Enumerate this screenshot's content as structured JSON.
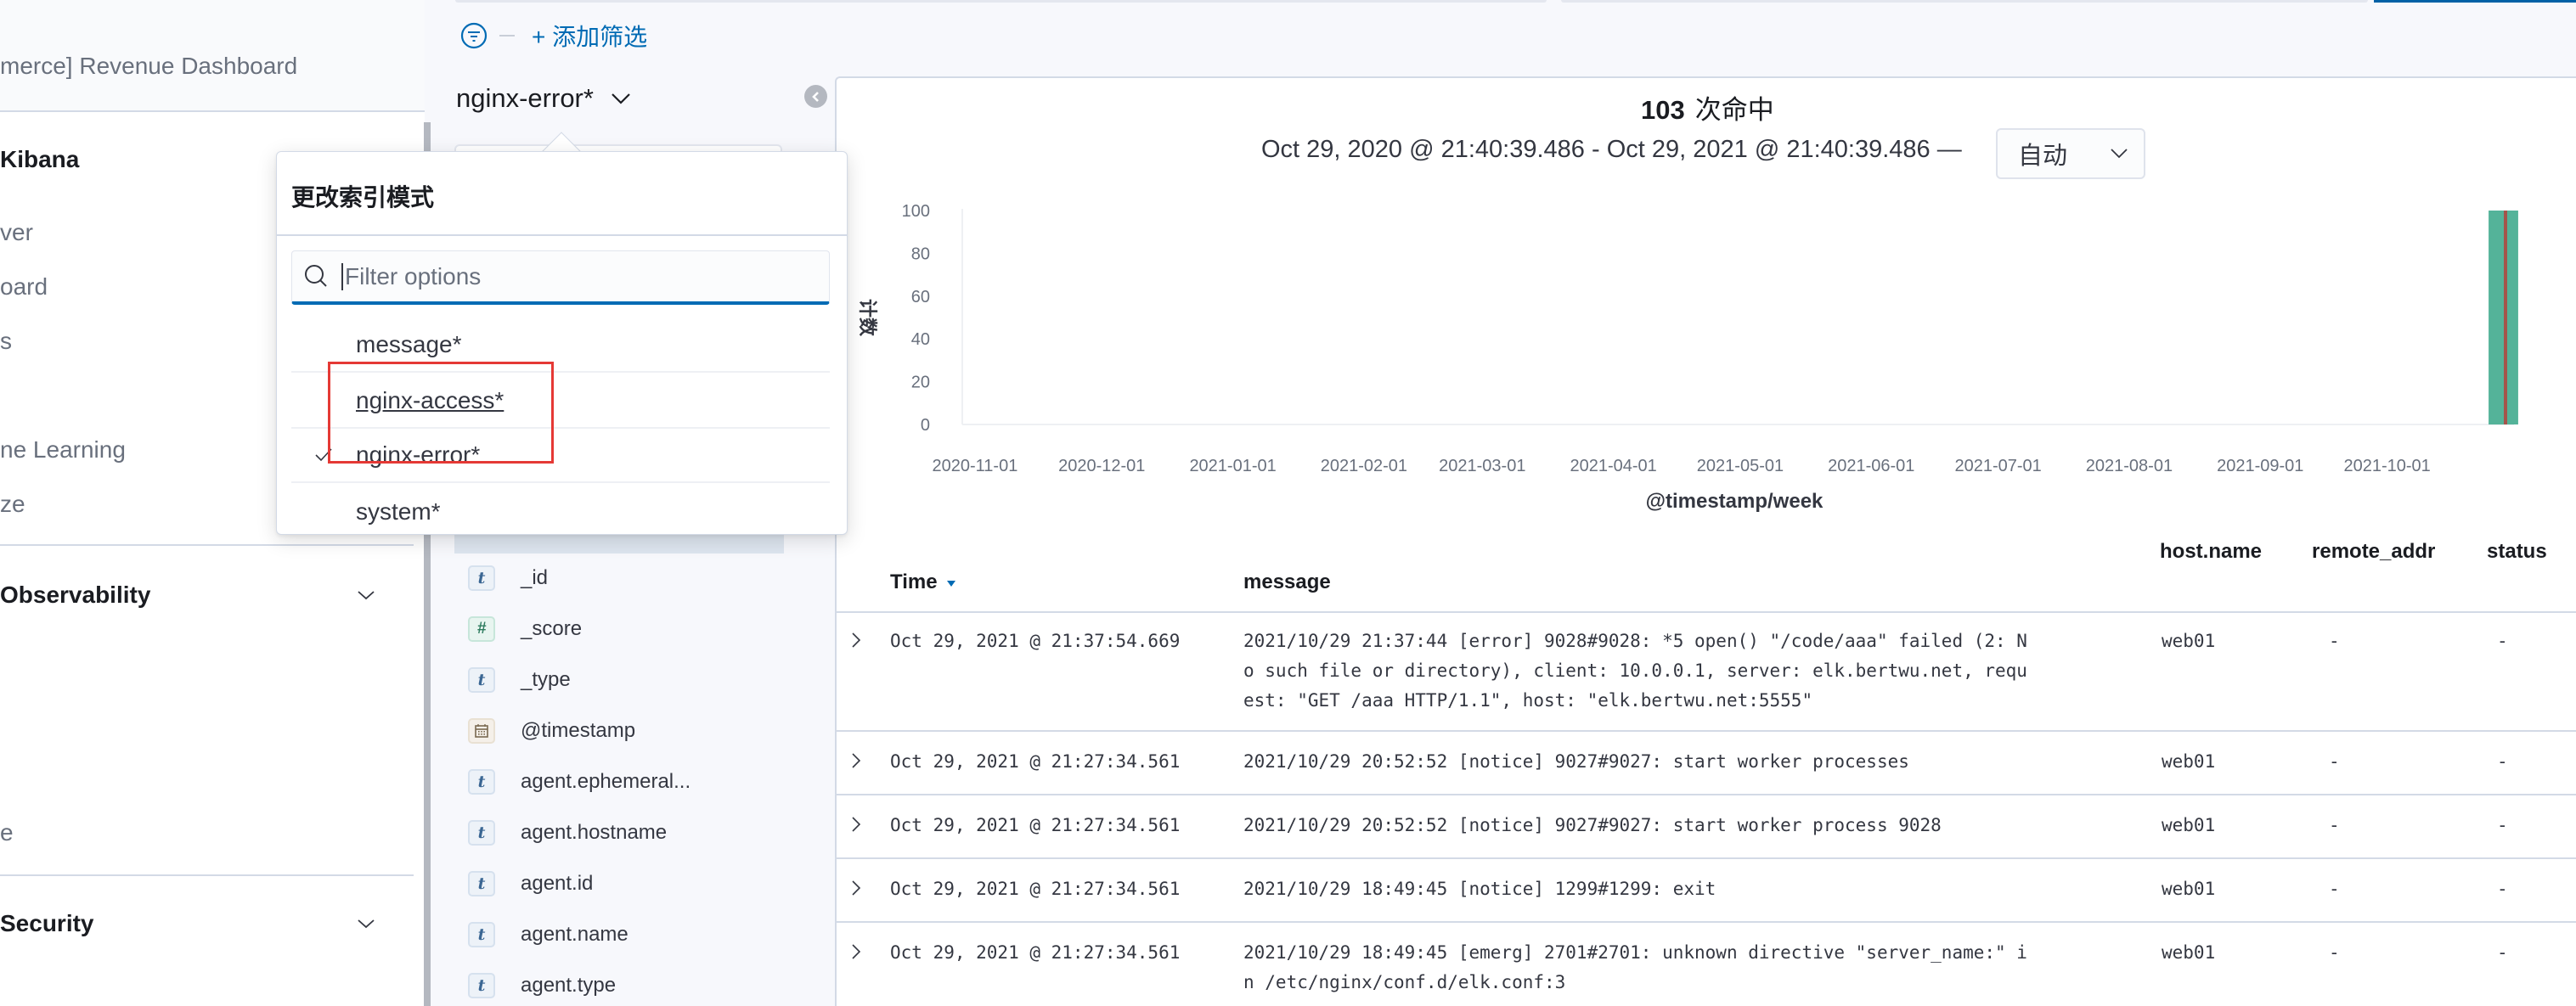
{
  "sidebar": {
    "recent_item": "merce] Revenue Dashboard",
    "groups": [
      {
        "title": "Kibana",
        "items": [
          "ver",
          "oard",
          "s",
          "",
          "ne Learning",
          "ze"
        ]
      },
      {
        "title": "Observability",
        "items": [
          "",
          "",
          "",
          "",
          "e"
        ]
      },
      {
        "title": "Security",
        "items": []
      }
    ]
  },
  "filter_bar": {
    "add_filter_label": "+ 添加筛选"
  },
  "index_selector": {
    "current": "nginx-error*"
  },
  "index_popover": {
    "title": "更改索引模式",
    "search_placeholder": "Filter options",
    "search_value": "",
    "options": [
      {
        "label": "message*",
        "selected": false,
        "focused": false
      },
      {
        "label": "nginx-access*",
        "selected": false,
        "focused": true
      },
      {
        "label": "nginx-error*",
        "selected": true,
        "focused": false
      },
      {
        "label": "system*",
        "selected": false,
        "focused": false
      }
    ]
  },
  "fields": [
    {
      "name": "_id",
      "type": "t"
    },
    {
      "name": "_score",
      "type": "#"
    },
    {
      "name": "_type",
      "type": "t"
    },
    {
      "name": "@timestamp",
      "type": "date"
    },
    {
      "name": "agent.ephemeral...",
      "type": "t"
    },
    {
      "name": "agent.hostname",
      "type": "t"
    },
    {
      "name": "agent.id",
      "type": "t"
    },
    {
      "name": "agent.name",
      "type": "t"
    },
    {
      "name": "agent.type",
      "type": "t"
    }
  ],
  "histogram": {
    "hits_count": "103",
    "hits_label": "次命中",
    "date_range": "Oct 29, 2020 @ 21:40:39.486 - Oct 29, 2021 @ 21:40:39.486 —",
    "interval": "自动"
  },
  "chart_data": {
    "type": "bar",
    "title": "",
    "xlabel": "@timestamp/week",
    "ylabel": "计数",
    "ylim": [
      0,
      100
    ],
    "yticks": [
      0,
      20,
      40,
      60,
      80,
      100
    ],
    "x_range": [
      "2020-10-29",
      "2021-10-29"
    ],
    "xticks": [
      "2020-11-01",
      "2020-12-01",
      "2021-01-01",
      "2021-02-01",
      "2021-03-01",
      "2021-04-01",
      "2021-05-01",
      "2021-06-01",
      "2021-07-01",
      "2021-08-01",
      "2021-09-01",
      "2021-10-01"
    ],
    "bars": [
      {
        "week_start": "2021-10-25",
        "count": 103
      }
    ],
    "now_marker": "2021-10-29",
    "bar_color": "#54b399",
    "marker_color": "#a4544a",
    "grid": false
  },
  "table": {
    "columns": [
      "Time",
      "message",
      "host.name",
      "remote_addr",
      "status"
    ],
    "sort_column": "Time",
    "sort_dir": "desc",
    "rows": [
      {
        "time": "Oct 29, 2021 @ 21:37:54.669",
        "message": "2021/10/29 21:37:44 [error] 9028#9028: *5 open() \"/code/aaa\" failed (2: N\no such file or directory), client: 10.0.0.1, server: elk.bertwu.net, requ\nest: \"GET /aaa HTTP/1.1\", host: \"elk.bertwu.net:5555\"",
        "host": "web01",
        "remote_addr": "-",
        "status": "-"
      },
      {
        "time": "Oct 29, 2021 @ 21:27:34.561",
        "message": "2021/10/29 20:52:52 [notice] 9027#9027: start worker processes",
        "host": "web01",
        "remote_addr": "-",
        "status": "-"
      },
      {
        "time": "Oct 29, 2021 @ 21:27:34.561",
        "message": "2021/10/29 20:52:52 [notice] 9027#9027: start worker process 9028",
        "host": "web01",
        "remote_addr": "-",
        "status": "-"
      },
      {
        "time": "Oct 29, 2021 @ 21:27:34.561",
        "message": "2021/10/29 18:49:45 [notice] 1299#1299: exit",
        "host": "web01",
        "remote_addr": "-",
        "status": "-"
      },
      {
        "time": "Oct 29, 2021 @ 21:27:34.561",
        "message": "2021/10/29 18:49:45 [emerg] 2701#2701: unknown directive \"server_name:\" i\nn /etc/nginx/conf.d/elk.conf:3",
        "host": "web01",
        "remote_addr": "-",
        "status": "-"
      }
    ]
  }
}
